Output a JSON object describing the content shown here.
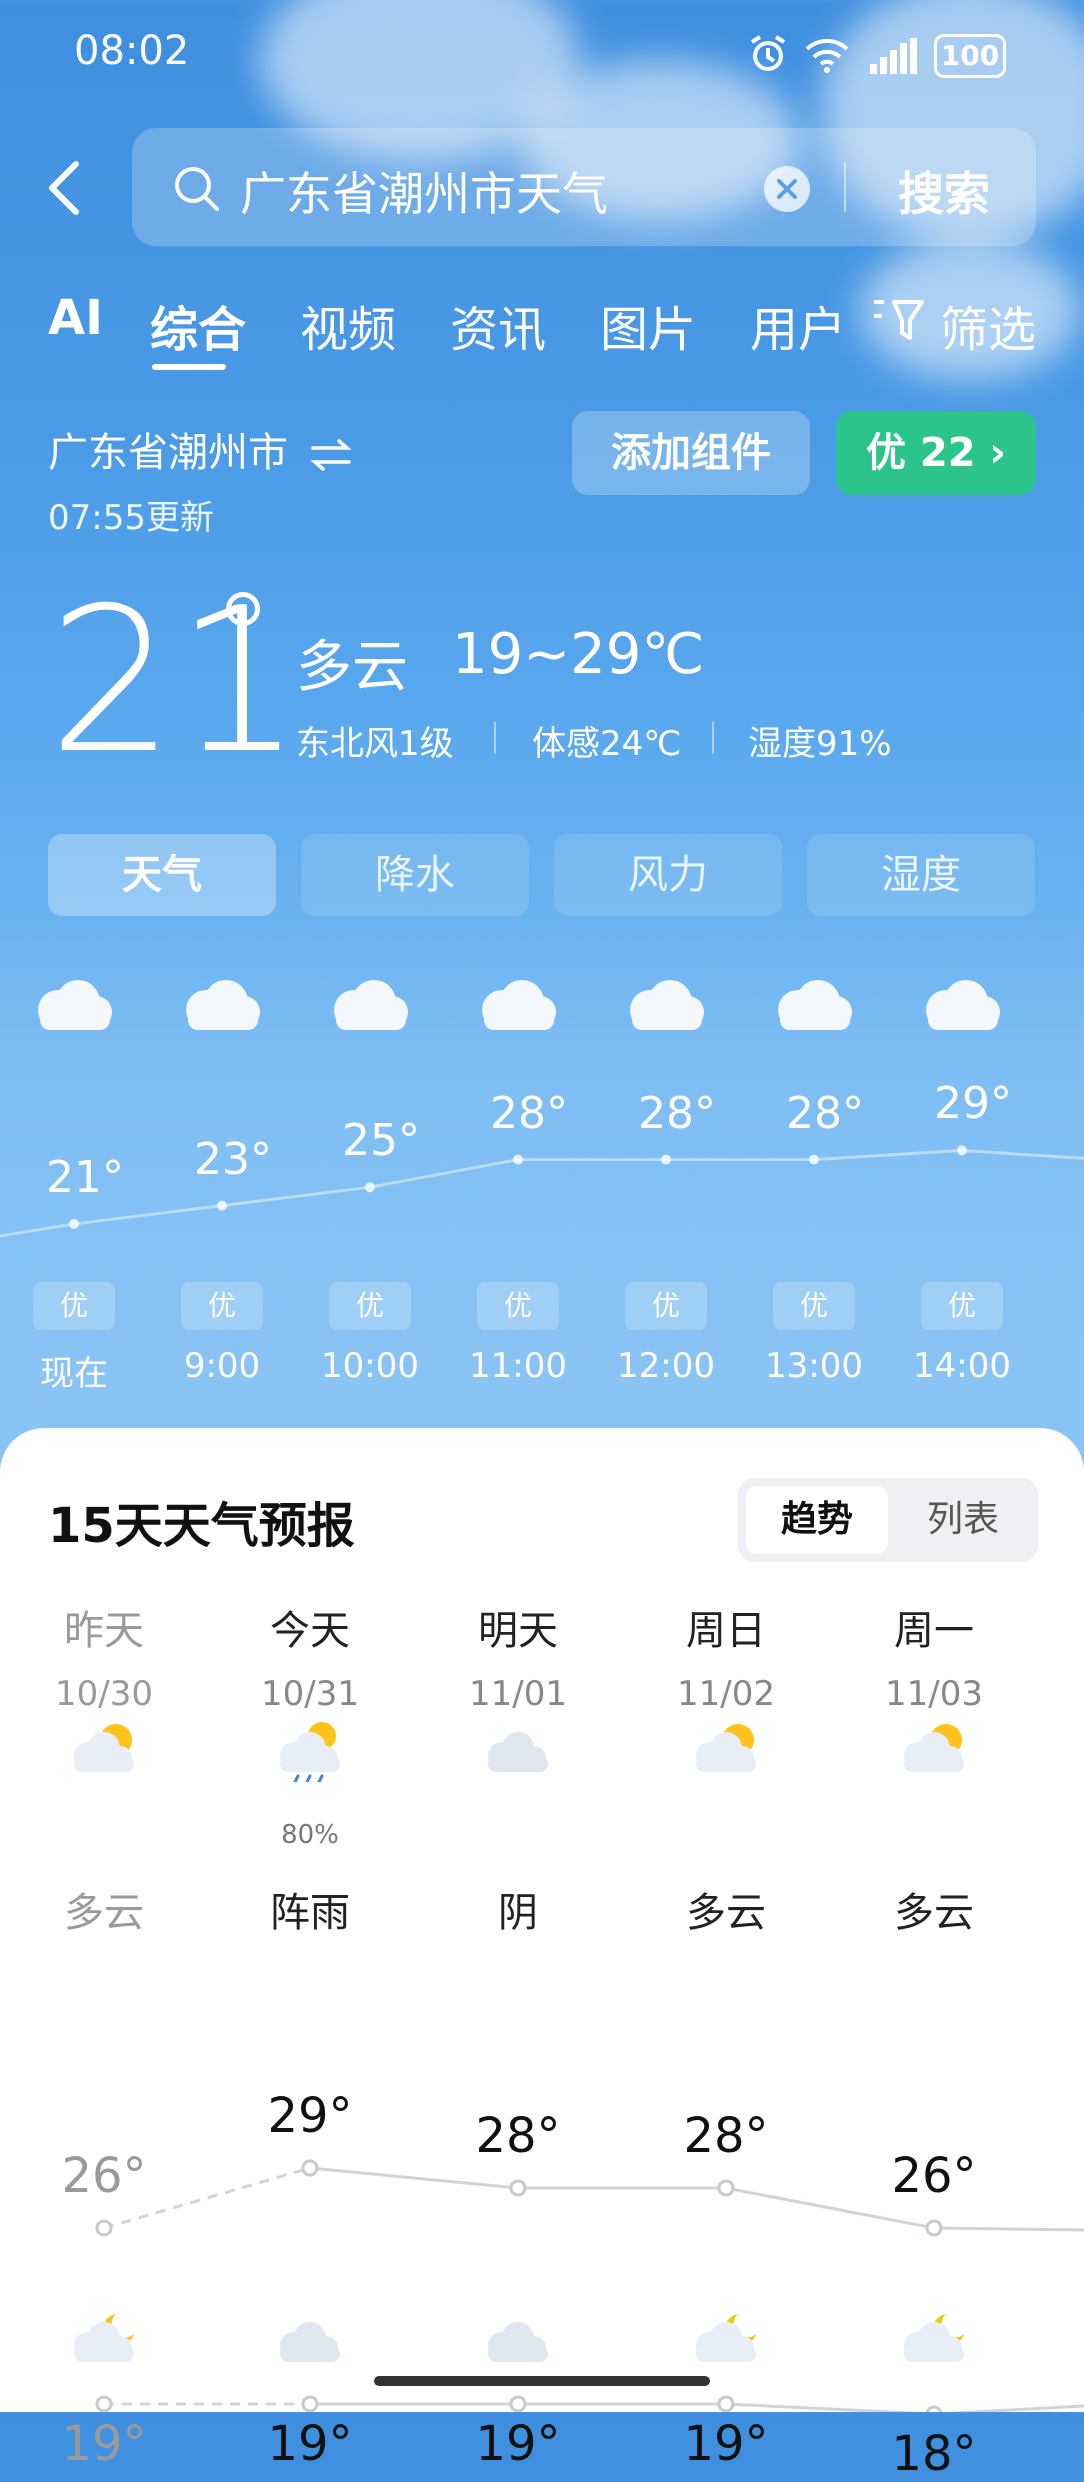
{
  "status_bar": {
    "time": "08:02",
    "battery": "100"
  },
  "search": {
    "query": "广东省潮州市天气",
    "submit_label": "搜索"
  },
  "tabs": [
    {
      "label": "AI"
    },
    {
      "label": "综合"
    },
    {
      "label": "视频"
    },
    {
      "label": "资讯"
    },
    {
      "label": "图片"
    },
    {
      "label": "用户"
    },
    {
      "label": "筛选"
    }
  ],
  "location": {
    "name": "广东省潮州市",
    "updated": "07:55更新"
  },
  "actions": {
    "add_widget": "添加组件",
    "aqi": "优 22 ›"
  },
  "current": {
    "temp": "21",
    "condition": "多云",
    "range": "19~29℃",
    "wind": "东北风1级",
    "feels_like": "体感24℃",
    "humidity": "湿度91%"
  },
  "segments": [
    {
      "label": "天气"
    },
    {
      "label": "降水"
    },
    {
      "label": "风力"
    },
    {
      "label": "湿度"
    }
  ],
  "hourly": [
    {
      "time": "现在",
      "temp": "21°",
      "aqi": "优",
      "t": 21
    },
    {
      "time": "9:00",
      "temp": "23°",
      "aqi": "优",
      "t": 23
    },
    {
      "time": "10:00",
      "temp": "25°",
      "aqi": "优",
      "t": 25
    },
    {
      "time": "11:00",
      "temp": "28°",
      "aqi": "优",
      "t": 28
    },
    {
      "time": "12:00",
      "temp": "28°",
      "aqi": "优",
      "t": 28
    },
    {
      "time": "13:00",
      "temp": "28°",
      "aqi": "优",
      "t": 28
    },
    {
      "time": "14:00",
      "temp": "29°",
      "aqi": "优",
      "t": 29
    }
  ],
  "forecast": {
    "title": "15天天气预报",
    "view_trend": "趋势",
    "view_list": "列表",
    "days": [
      {
        "name": "昨天",
        "date": "10/30",
        "icon": "partly-cloudy-icon",
        "precip": "",
        "cond": "多云",
        "high": "26°",
        "low": "19°",
        "h": 26,
        "l": 19,
        "past": true
      },
      {
        "name": "今天",
        "date": "10/31",
        "icon": "shower-icon",
        "precip": "80%",
        "cond": "阵雨",
        "high": "29°",
        "low": "19°",
        "h": 29,
        "l": 19,
        "past": false
      },
      {
        "name": "明天",
        "date": "11/01",
        "icon": "overcast-icon",
        "precip": "",
        "cond": "阴",
        "high": "28°",
        "low": "19°",
        "h": 28,
        "l": 19,
        "past": false
      },
      {
        "name": "周日",
        "date": "11/02",
        "icon": "partly-cloudy-icon",
        "precip": "",
        "cond": "多云",
        "high": "28°",
        "low": "19°",
        "h": 28,
        "l": 19,
        "past": false
      },
      {
        "name": "周一",
        "date": "11/03",
        "icon": "partly-cloudy-icon",
        "precip": "",
        "cond": "多云",
        "high": "26°",
        "low": "18°",
        "h": 26,
        "l": 18,
        "past": false
      }
    ]
  },
  "colors": {
    "accent_green": "#2bc48a",
    "sky_top": "#3f8fe0",
    "sky_bottom": "#8ac4f4"
  }
}
